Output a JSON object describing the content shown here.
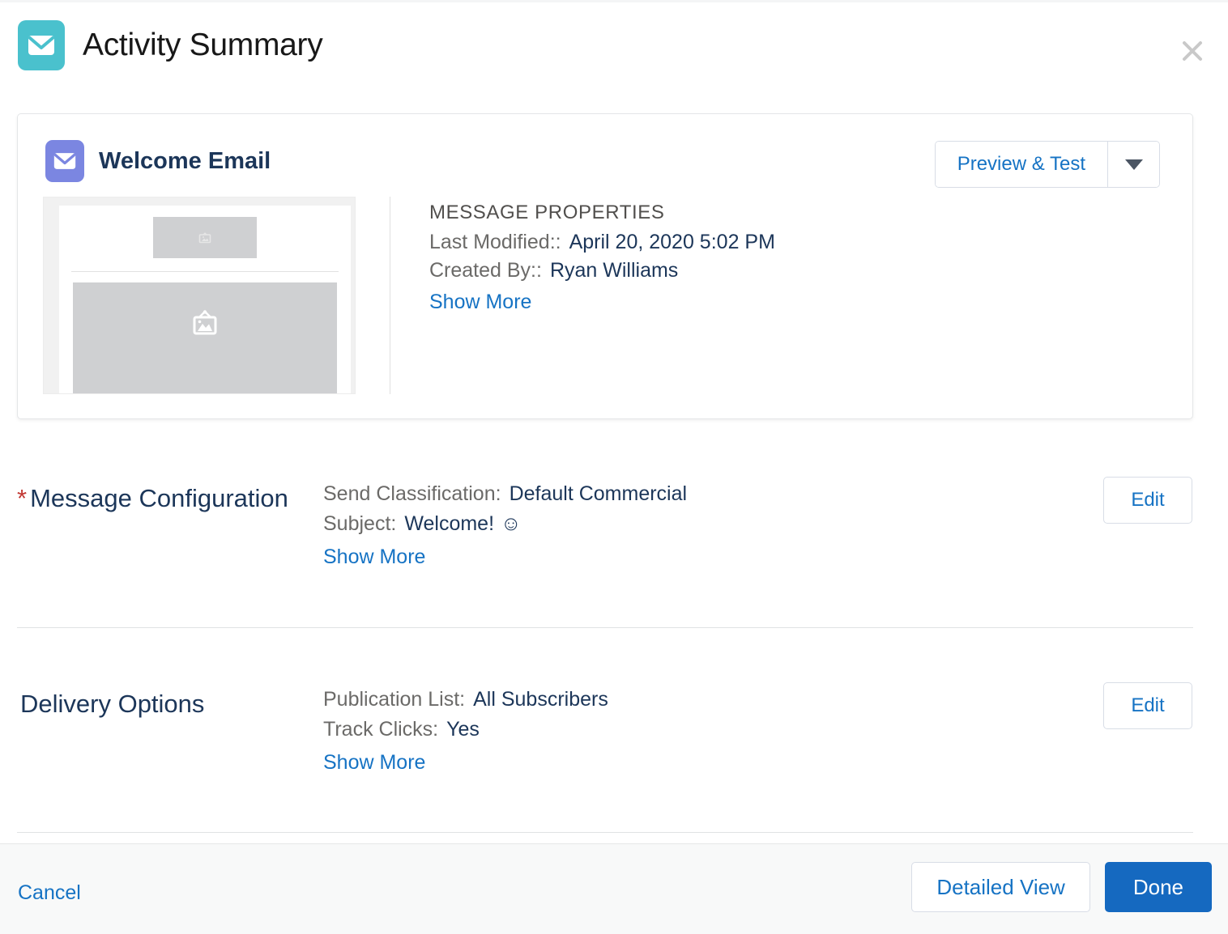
{
  "colors": {
    "brand_blue": "#1569c0",
    "link_blue": "#1673c4",
    "header_icon_teal": "#4ac1cd",
    "email_icon_purple": "#7b86e1",
    "heading_navy": "#1c3659",
    "required_red": "#c23934"
  },
  "header": {
    "title": "Activity Summary",
    "icon": "email-envelope-icon",
    "close_icon": "close-icon"
  },
  "email_card": {
    "icon": "email-envelope-icon",
    "name": "Welcome Email",
    "preview_button": "Preview & Test",
    "preview_dropdown_icon": "chevron-down-icon",
    "thumbnail": {
      "hero_placeholder_icon": "image-placeholder-icon",
      "body_placeholder_icon": "image-placeholder-icon"
    },
    "properties": {
      "title": "MESSAGE PROPERTIES",
      "rows": [
        {
          "label": "Last Modified::",
          "value": "April 20, 2020 5:02 PM"
        },
        {
          "label": "Created By::",
          "value": "Ryan Williams"
        }
      ],
      "show_more": "Show More"
    }
  },
  "sections": [
    {
      "id": "message",
      "required_marker": "*",
      "label": "Message Configuration",
      "rows": [
        {
          "label": "Send Classification:",
          "value": "Default Commercial",
          "suffix": ""
        },
        {
          "label": "Subject:",
          "value": "Welcome!",
          "suffix": "☺"
        }
      ],
      "show_more": "Show More",
      "edit_label": "Edit"
    },
    {
      "id": "delivery",
      "required_marker": "",
      "label": "Delivery Options",
      "rows": [
        {
          "label": "Publication List:",
          "value": "All Subscribers",
          "suffix": ""
        },
        {
          "label": "Track Clicks:",
          "value": "Yes",
          "suffix": ""
        }
      ],
      "show_more": "Show More",
      "edit_label": "Edit"
    }
  ],
  "footer": {
    "cancel_label": "Cancel",
    "detailed_view_label": "Detailed View",
    "done_label": "Done"
  }
}
